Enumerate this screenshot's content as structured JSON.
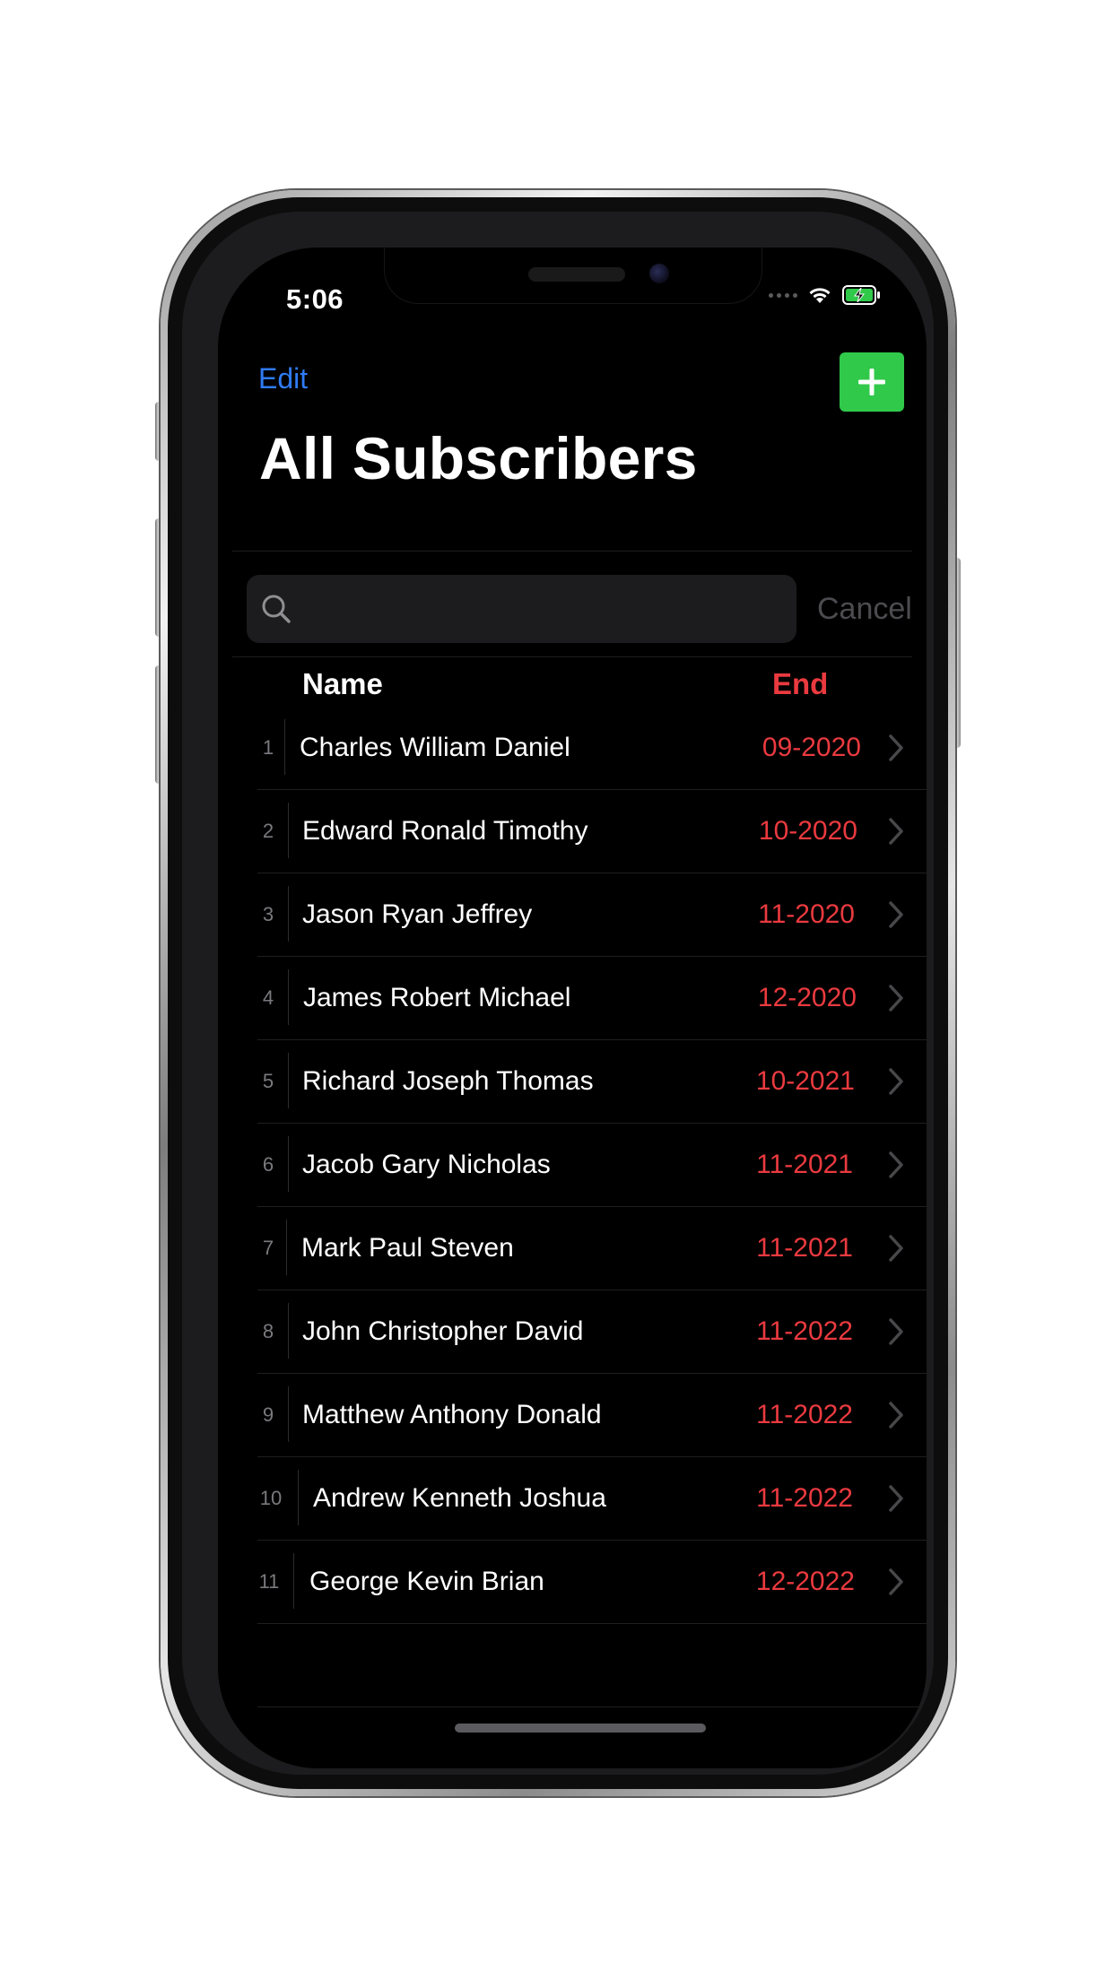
{
  "status_bar": {
    "time": "5:06",
    "icons": [
      "signal-dots-icon",
      "wifi-icon",
      "battery-charging-icon"
    ]
  },
  "nav": {
    "edit_label": "Edit",
    "add_icon": "plus-icon",
    "title": "All Subscribers"
  },
  "search": {
    "value": "",
    "placeholder": "",
    "icon": "search-icon",
    "cancel_label": "Cancel"
  },
  "table": {
    "headers": {
      "name": "Name",
      "end": "End"
    },
    "rows": [
      {
        "index": "1",
        "name": "Charles William Daniel",
        "end": "09-2020"
      },
      {
        "index": "2",
        "name": "Edward Ronald Timothy",
        "end": "10-2020"
      },
      {
        "index": "3",
        "name": "Jason Ryan Jeffrey",
        "end": "11-2020"
      },
      {
        "index": "4",
        "name": "James Robert Michael",
        "end": "12-2020"
      },
      {
        "index": "5",
        "name": "Richard Joseph Thomas",
        "end": "10-2021"
      },
      {
        "index": "6",
        "name": "Jacob Gary Nicholas",
        "end": "11-2021"
      },
      {
        "index": "7",
        "name": "Mark Paul Steven",
        "end": "11-2021"
      },
      {
        "index": "8",
        "name": "John Christopher David",
        "end": "11-2022"
      },
      {
        "index": "9",
        "name": "Matthew Anthony Donald",
        "end": "11-2022"
      },
      {
        "index": "10",
        "name": "Andrew Kenneth Joshua",
        "end": "11-2022"
      },
      {
        "index": "11",
        "name": "George Kevin Brian",
        "end": "12-2022"
      }
    ]
  },
  "colors": {
    "background": "#000000",
    "accent_blue": "#2f7bf5",
    "add_green": "#30c94a",
    "date_red": "#ea3a3f",
    "muted_gray": "#4c4c50"
  }
}
